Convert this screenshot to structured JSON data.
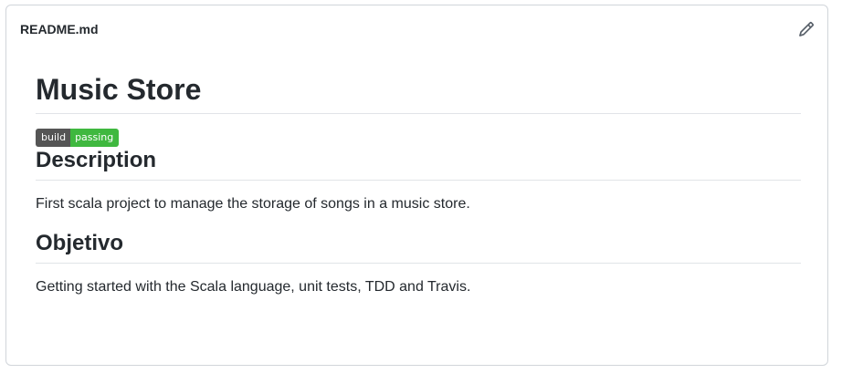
{
  "readme": {
    "filename": "README.md",
    "edit_icon": "pencil-icon"
  },
  "content": {
    "title": "Music Store",
    "badge": {
      "left": "build",
      "right": "passing",
      "left_color": "#555555",
      "right_color": "#3fb83f"
    },
    "sections": [
      {
        "heading": "Description",
        "text": "First scala project to manage the storage of songs in a music store."
      },
      {
        "heading": "Objetivo",
        "text": "Getting started with the Scala language, unit tests, TDD and Travis."
      }
    ]
  }
}
